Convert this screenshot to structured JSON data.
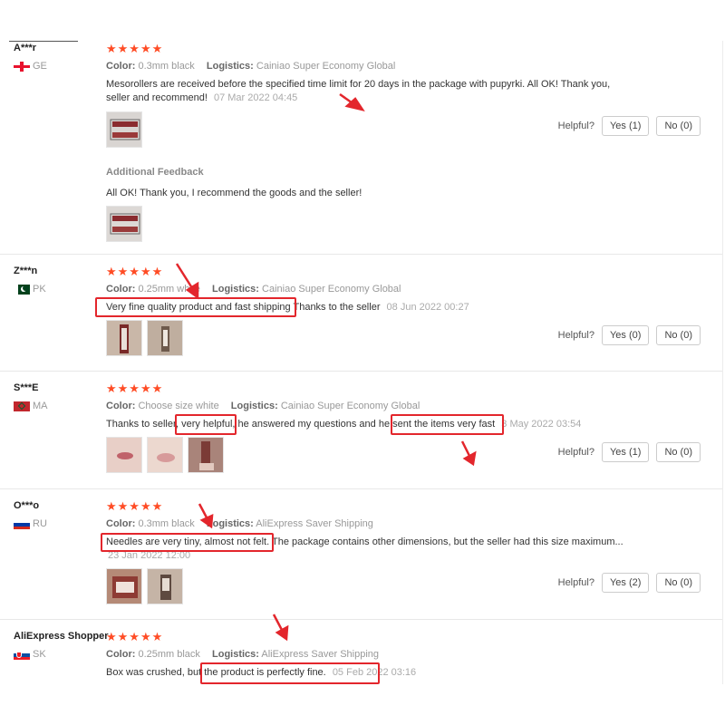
{
  "reviews": [
    {
      "user": "A***r",
      "country": "GE",
      "stars": "★★★★★",
      "color_label": "Color:",
      "color": "0.3mm black",
      "logistics_label": "Logistics:",
      "logistics": "Cainiao Super Economy Global",
      "text": "Mesorollers are received before the specified time limit for 20 days in the package with pupyrki. All OK! Thank you, seller and recommend!",
      "date": "07 Mar 2022 04:45",
      "helpful_label": "Helpful?",
      "yes": "Yes (1)",
      "no": "No (0)",
      "additional_label": "Additional Feedback",
      "additional_text": "All OK! Thank you, I recommend the goods and the seller!"
    },
    {
      "user": "Z***n",
      "country": "PK",
      "stars": "★★★★★",
      "color_label": "Color:",
      "color": "0.25mm white",
      "logistics_label": "Logistics:",
      "logistics": "Cainiao Super Economy Global",
      "text": "Very fine quality product and fast shipping Thanks to the seller",
      "date": "08 Jun 2022 00:27",
      "helpful_label": "Helpful?",
      "yes": "Yes (0)",
      "no": "No (0)"
    },
    {
      "user": "S***E",
      "country": "MA",
      "stars": "★★★★★",
      "color_label": "Color:",
      "color": "Choose size white",
      "logistics_label": "Logistics:",
      "logistics": "Cainiao Super Economy Global",
      "text": "Thanks to seller, very helpful, he answered my questions and he sent the items very fast",
      "date": "3 May 2022 03:54",
      "helpful_label": "Helpful?",
      "yes": "Yes (1)",
      "no": "No (0)"
    },
    {
      "user": "O***o",
      "country": "RU",
      "stars": "★★★★★",
      "color_label": "Color:",
      "color": "0.3mm black",
      "logistics_label": "Logistics:",
      "logistics": "AliExpress Saver Shipping",
      "text": "Needles are very tiny, almost not felt. The package contains other dimensions, but the seller had this size maximum...",
      "date": "23 Jan 2022 12:00",
      "helpful_label": "Helpful?",
      "yes": "Yes (2)",
      "no": "No (0)"
    },
    {
      "user": "AliExpress Shopper",
      "country": "SK",
      "stars": "★★★★★",
      "color_label": "Color:",
      "color": "0.25mm black",
      "logistics_label": "Logistics:",
      "logistics": "AliExpress Saver Shipping",
      "text": "Box was crushed, but the product is perfectly fine.",
      "date": "05 Feb 2022 03:16"
    }
  ],
  "colors": {
    "star": "#ff4c25",
    "highlight": "#e3262c"
  }
}
